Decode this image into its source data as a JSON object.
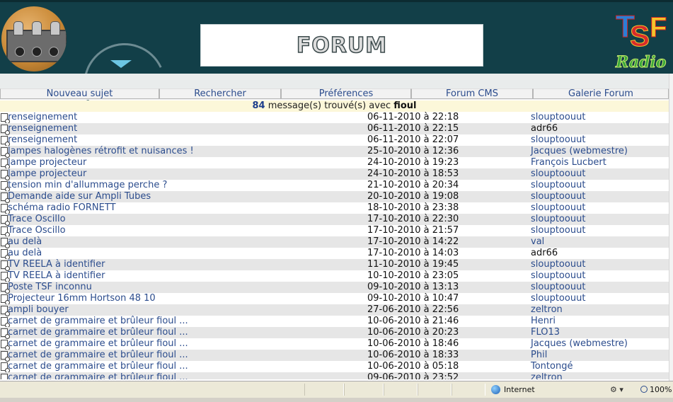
{
  "header": {
    "banner_title": "FORUM",
    "logo_letters": [
      "T",
      "S",
      "F"
    ],
    "logo_subtitle": "Radio"
  },
  "nav": [
    {
      "label": "Nouveau sujet"
    },
    {
      "label": "Rechercher"
    },
    {
      "label": "Préférences"
    },
    {
      "label": "Forum CMS"
    },
    {
      "label": "Galerie Forum"
    }
  ],
  "summary": {
    "count": "84",
    "text": "message(s) trouvé(s) avec",
    "keyword": "fioul"
  },
  "results": [
    {
      "subject": "renseignement",
      "date": "06-11-2010 à 22:18",
      "author": "slouptoouut",
      "author_link": true
    },
    {
      "subject": "renseignement",
      "date": "06-11-2010 à 22:15",
      "author": "adr66",
      "author_link": false
    },
    {
      "subject": "renseignement",
      "date": "06-11-2010 à 22:07",
      "author": "slouptoouut",
      "author_link": true
    },
    {
      "subject": "lampes halogènes rétrofit et nuisances !",
      "date": "25-10-2010 à 12:36",
      "author": "Jacques (webmestre)",
      "author_link": true
    },
    {
      "subject": "lampe projecteur",
      "date": "24-10-2010 à 19:23",
      "author": "François Lucbert",
      "author_link": true
    },
    {
      "subject": "lampe projecteur",
      "date": "24-10-2010 à 18:53",
      "author": "slouptoouut",
      "author_link": true
    },
    {
      "subject": "tension min d'allummage perche ?",
      "date": "21-10-2010 à 20:34",
      "author": "slouptoouut",
      "author_link": true
    },
    {
      "subject": "Demande aide sur Ampli Tubes",
      "date": "20-10-2010 à 19:08",
      "author": "slouptoouut",
      "author_link": true
    },
    {
      "subject": "schéma radio FORNETT",
      "date": "18-10-2010 à 23:38",
      "author": "slouptoouut",
      "author_link": true
    },
    {
      "subject": "Trace Oscillo",
      "date": "17-10-2010 à 22:30",
      "author": "slouptoouut",
      "author_link": true
    },
    {
      "subject": "Trace Oscillo",
      "date": "17-10-2010 à 21:57",
      "author": "slouptoouut",
      "author_link": true
    },
    {
      "subject": "au delà",
      "date": "17-10-2010 à 14:22",
      "author": "val",
      "author_link": true
    },
    {
      "subject": "au delà",
      "date": "17-10-2010 à 14:03",
      "author": "adr66",
      "author_link": false
    },
    {
      "subject": "TV REELA à identifier",
      "date": "11-10-2010 à 19:45",
      "author": "slouptoouut",
      "author_link": true
    },
    {
      "subject": "TV REELA à identifier",
      "date": "10-10-2010 à 23:05",
      "author": "slouptoouut",
      "author_link": true
    },
    {
      "subject": "Poste TSF inconnu",
      "date": "09-10-2010 à 13:13",
      "author": "slouptoouut",
      "author_link": true
    },
    {
      "subject": "Projecteur 16mm Hortson 48 10",
      "date": "09-10-2010 à 10:47",
      "author": "slouptoouut",
      "author_link": true
    },
    {
      "subject": "ampli bouyer",
      "date": "27-06-2010 à 22:56",
      "author": "zeltron",
      "author_link": true
    },
    {
      "subject": "carnet de grammaire et brûleur fioul ...",
      "date": "10-06-2010 à 21:46",
      "author": "Henri",
      "author_link": true
    },
    {
      "subject": "carnet de grammaire et brûleur fioul ...",
      "date": "10-06-2010 à 20:23",
      "author": "FLO13",
      "author_link": true
    },
    {
      "subject": "carnet de grammaire et brûleur fioul ...",
      "date": "10-06-2010 à 18:46",
      "author": "Jacques (webmestre)",
      "author_link": true
    },
    {
      "subject": "carnet de grammaire et brûleur fioul ...",
      "date": "10-06-2010 à 18:33",
      "author": "Phil",
      "author_link": true
    },
    {
      "subject": "carnet de grammaire et brûleur fioul ...",
      "date": "10-06-2010 à 05:18",
      "author": "Tontongé",
      "author_link": true
    },
    {
      "subject": "carnet de grammaire et brûleur fioul ...",
      "date": "09-06-2010 à 23:52",
      "author": "zeltron",
      "author_link": true
    }
  ],
  "statusbar": {
    "zone": "Internet",
    "zoom": "100%",
    "icons": [
      "globe-icon",
      "security-icon",
      "zoom-icon"
    ]
  }
}
